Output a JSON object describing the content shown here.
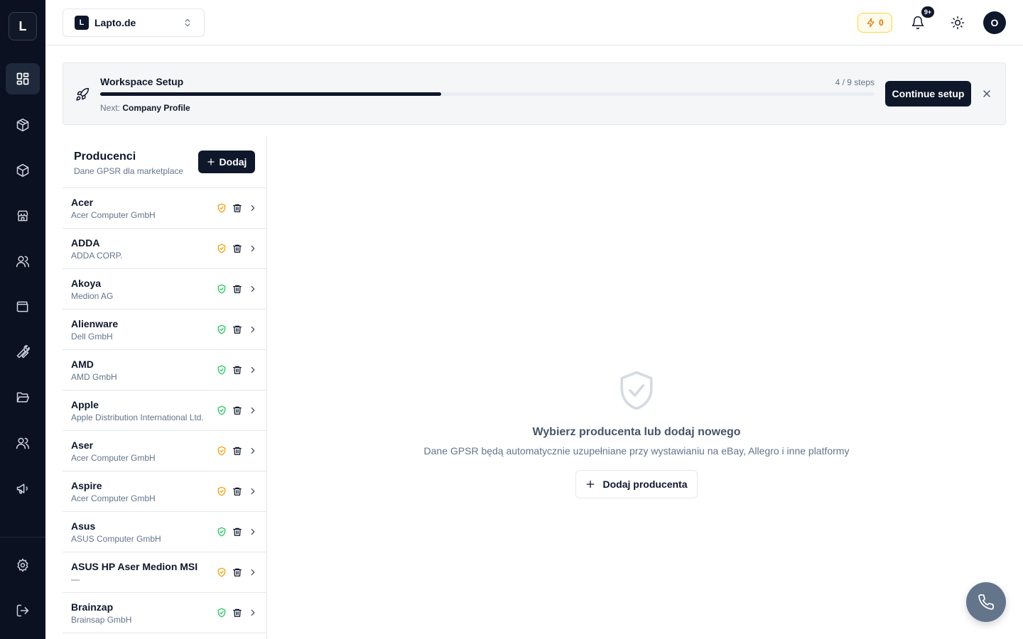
{
  "app": {
    "logo_letter": "L"
  },
  "workspace": {
    "badge": "L",
    "name": "Lapto.de"
  },
  "topbar": {
    "credits": "0",
    "notifications_badge": "9+",
    "avatar_letter": "O"
  },
  "setup": {
    "title": "Workspace Setup",
    "steps": "4 / 9 steps",
    "progress": 0.44,
    "next_label": "Next:",
    "next_value": "Company Profile",
    "continue_label": "Continue setup"
  },
  "producers": {
    "title": "Producenci",
    "subtitle": "Dane GPSR dla marketplace",
    "add_label": "Dodaj",
    "items": [
      {
        "name": "Acer",
        "company": "Acer Computer GmbH",
        "status": "warning"
      },
      {
        "name": "ADDA",
        "company": "ADDA CORP.",
        "status": "warning"
      },
      {
        "name": "Akoya",
        "company": "Medion AG",
        "status": "ok"
      },
      {
        "name": "Alienware",
        "company": "Dell GmbH",
        "status": "ok"
      },
      {
        "name": "AMD",
        "company": "AMD GmbH",
        "status": "ok"
      },
      {
        "name": "Apple",
        "company": "Apple Distribution International Ltd.",
        "status": "ok"
      },
      {
        "name": "Aser",
        "company": "Acer Computer GmbH",
        "status": "warning"
      },
      {
        "name": "Aspire",
        "company": "Acer Computer GmbH",
        "status": "warning"
      },
      {
        "name": "Asus",
        "company": "ASUS Computer GmbH",
        "status": "ok"
      },
      {
        "name": "ASUS HP Aser Medion MSI",
        "company": "—",
        "status": "warning"
      },
      {
        "name": "Brainzap",
        "company": "Brainsap GmbH",
        "status": "ok"
      }
    ]
  },
  "empty_state": {
    "title": "Wybierz producenta lub dodaj nowego",
    "subtitle": "Dane GPSR będą automatycznie uzupełniane przy wystawianiu na eBay, Allegro i inne platformy",
    "button_label": "Dodaj producenta"
  },
  "colors": {
    "ok": "#22c55e",
    "warning": "#f59e0b",
    "dark": "#0f172a"
  }
}
